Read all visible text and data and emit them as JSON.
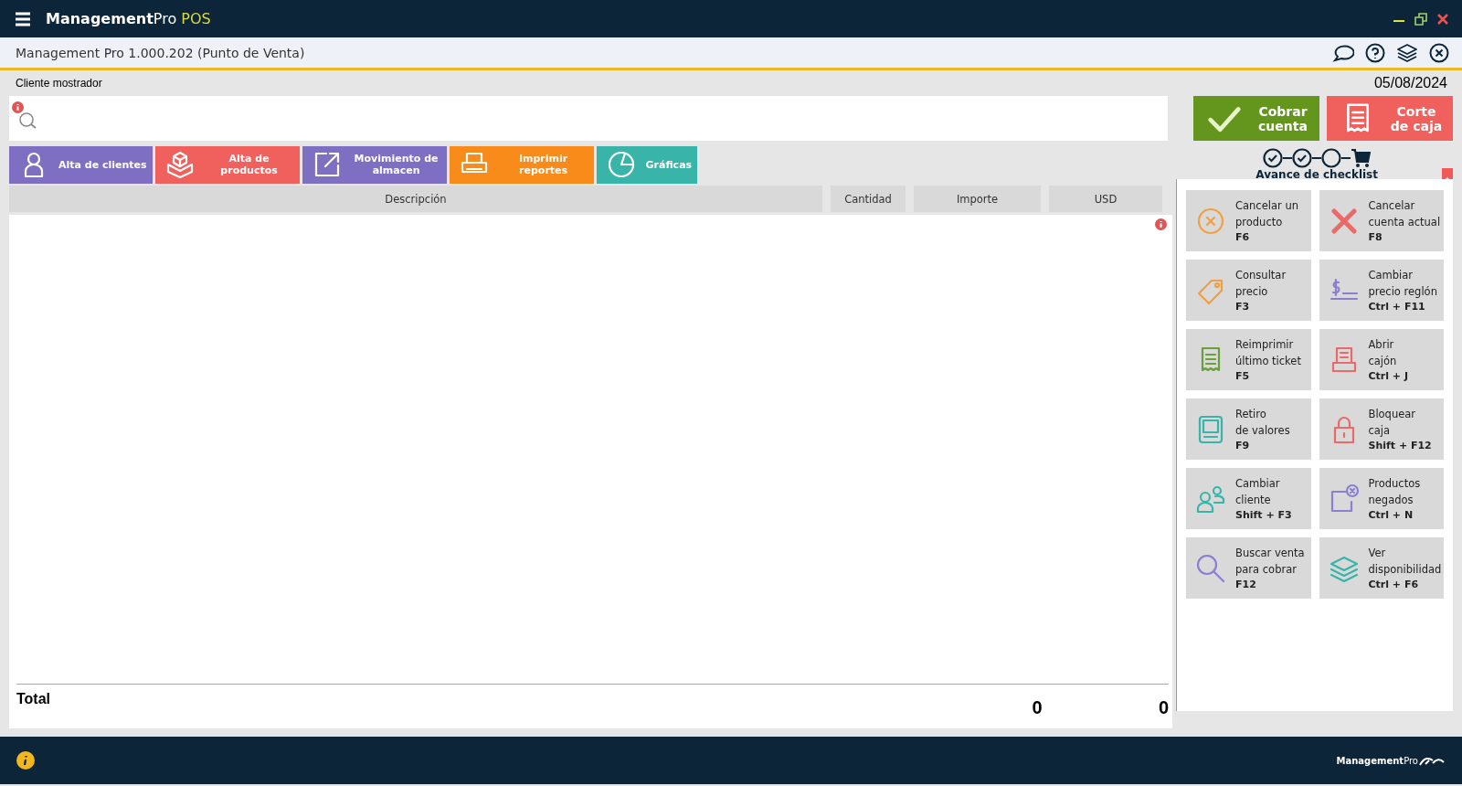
{
  "title_bar": {
    "brand_bold": "Management",
    "brand_light": "Pro",
    "brand_suffix": "POS"
  },
  "header": {
    "title": "Management Pro 1.000.202 (Punto de Venta)"
  },
  "customer": "Cliente mostrador",
  "date": "05/08/2024",
  "actions": [
    {
      "kind": "check",
      "label": "Cobrar cuenta",
      "color": "#64961e"
    },
    {
      "kind": "receipt",
      "label": "Corte de caja",
      "color": "#f0605c"
    }
  ],
  "quick_buttons": [
    {
      "kind": "person",
      "label": "Alta de clientes",
      "color": "#7e6fc2"
    },
    {
      "kind": "boxes",
      "label": "Alta de productos",
      "color": "#f0605c"
    },
    {
      "kind": "external",
      "label": "Movimiento de almacen",
      "color": "#7e6fc2"
    },
    {
      "kind": "printer",
      "label": "Imprimir reportes",
      "color": "#f98b1a"
    },
    {
      "kind": "pie",
      "label": "Gráficas",
      "color": "#38b5a8"
    }
  ],
  "checklist": {
    "label": "Avance de checklist",
    "steps": [
      {
        "done": true
      },
      {
        "done": true
      },
      {
        "done": false
      }
    ]
  },
  "table": {
    "columns": [
      "Descripción",
      "Cantidad",
      "Importe",
      "USD"
    ]
  },
  "totals": {
    "label": "Total",
    "values": [
      "0",
      "0"
    ]
  },
  "shortcuts": [
    {
      "kind": "cancel-circle",
      "line1": "Cancelar un",
      "line2": "producto",
      "key": "F6",
      "color": "#f0a040"
    },
    {
      "kind": "cross",
      "line1": "Cancelar",
      "line2": "cuenta actual",
      "key": "F8",
      "color": "#ea6a6a"
    },
    {
      "kind": "tag",
      "line1": "Consultar",
      "line2": "precio",
      "key": "F3",
      "color": "#f0a040"
    },
    {
      "kind": "dollar",
      "line1": "Cambiar",
      "line2": "precio reglón",
      "key": "Ctrl + F11",
      "color": "#8a7fd0"
    },
    {
      "kind": "receipt",
      "line1": "Reimprimir",
      "line2": "último ticket",
      "key": "F5",
      "color": "#6aa03a"
    },
    {
      "kind": "register",
      "line1": "Abrir",
      "line2": "cajón",
      "key": "Ctrl + J",
      "color": "#ea6a6a"
    },
    {
      "kind": "terminal",
      "line1": "Retiro",
      "line2": "de valores",
      "key": "F9",
      "color": "#38b5a8"
    },
    {
      "kind": "lock",
      "line1": "Bloquear",
      "line2": "caja",
      "key": "Shift + F12",
      "color": "#ea6a6a"
    },
    {
      "kind": "users",
      "line1": "Cambiar",
      "line2": "cliente",
      "key": "Shift + F3",
      "color": "#38b5a8"
    },
    {
      "kind": "denied",
      "line1": "Productos",
      "line2": "negados",
      "key": "Ctrl + N",
      "color": "#8a7fd0"
    },
    {
      "kind": "search",
      "line1": "Buscar venta",
      "line2": "para cobrar",
      "key": "F12",
      "color": "#8a7fd0"
    },
    {
      "kind": "layers",
      "line1": "Ver",
      "line2": "disponibilidad",
      "key": "Ctrl + F6",
      "color": "#38b5a8"
    }
  ],
  "footer": {
    "brand_bold": "Management",
    "brand_light": "Pro"
  }
}
